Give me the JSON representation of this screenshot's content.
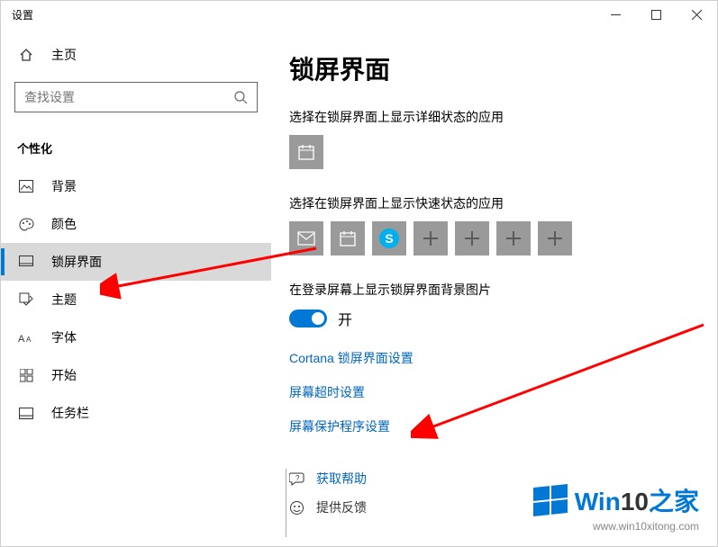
{
  "window": {
    "title": "设置"
  },
  "sidebar": {
    "home": "主页",
    "search_placeholder": "查找设置",
    "section": "个性化",
    "items": [
      {
        "label": "背景"
      },
      {
        "label": "颜色"
      },
      {
        "label": "锁屏界面"
      },
      {
        "label": "主题"
      },
      {
        "label": "字体"
      },
      {
        "label": "开始"
      },
      {
        "label": "任务栏"
      }
    ]
  },
  "main": {
    "title": "锁屏界面",
    "detail_label": "选择在锁屏界面上显示详细状态的应用",
    "quick_label": "选择在锁屏界面上显示快速状态的应用",
    "bg_label": "在登录屏幕上显示锁屏界面背景图片",
    "toggle_state": "开",
    "links": {
      "cortana": "Cortana 锁屏界面设置",
      "timeout": "屏幕超时设置",
      "saver": "屏幕保护程序设置"
    },
    "help": "获取帮助",
    "feedback": "提供反馈"
  },
  "watermark": {
    "brand_prefix": "Win",
    "brand_suffix": "10",
    "brand_tail": "之家",
    "url": "www.win10xitong.com"
  }
}
